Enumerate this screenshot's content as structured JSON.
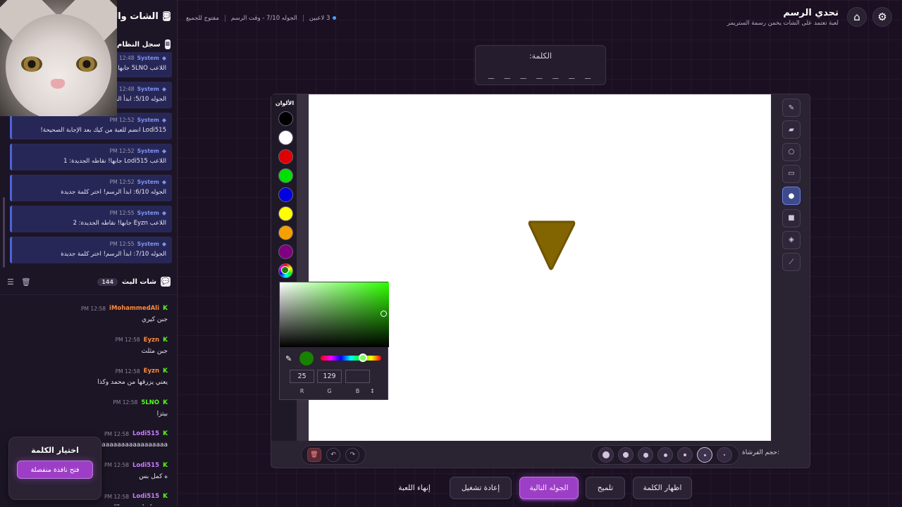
{
  "header": {
    "title": "تحدي الرسم",
    "subtitle": "لعبة تعتمد على الشات يخمن رسمة الستريمر",
    "status": {
      "players": "3 لاعبين",
      "round": "الجوله 7/10 - وقت الرسم",
      "open": "مفتوح للجميع"
    }
  },
  "sidebar": {
    "title": "الشات والس",
    "system_log_title": "سجل النظام",
    "system_messages": [
      {
        "sender": "System",
        "time": "12:48 PM",
        "text": "اللاعب 5LNO جابها! نقاطه الجديدة: 1"
      },
      {
        "sender": "System",
        "time": "12:48 PM",
        "text": "الجوله 5/10: ابدأ الرسم! اختر كلمة جديدة"
      },
      {
        "sender": "System",
        "time": "12:52 PM",
        "text": "Lodi515 انضم للعبة من كيك بعد الإجابة الصحيحة!"
      },
      {
        "sender": "System",
        "time": "12:52 PM",
        "text": "اللاعب Lodi515 جابها! نقاطه الجديدة: 1"
      },
      {
        "sender": "System",
        "time": "12:52 PM",
        "text": "الجوله 6/10: ابدأ الرسم! اختر كلمة جديدة"
      },
      {
        "sender": "System",
        "time": "12:55 PM",
        "text": "اللاعب Eyzn جابها! نقاطه الجديدة: 2"
      },
      {
        "sender": "System",
        "time": "12:55 PM",
        "text": "الجوله 7/10: ابدأ الرسم! اختر كلمة جديدة"
      }
    ],
    "chat_title": "شات البث",
    "chat_count": "144",
    "chat_messages": [
      {
        "user": "iMohammedAli",
        "time": "12:58 PM",
        "text": "جبن كيري",
        "color": "#ff8a3d"
      },
      {
        "user": "Eyzn",
        "time": "12:58 PM",
        "text": "جبن مثلث",
        "color": "#ff8a3d"
      },
      {
        "user": "Eyzn",
        "time": "12:58 PM",
        "text": "يعني يزرقها من محمد وكذا",
        "color": "#ff8a3d"
      },
      {
        "user": "5LNO",
        "time": "12:58 PM",
        "text": "بيتزا",
        "color": "#53fc18"
      },
      {
        "user": "Lodi515",
        "time": "12:58 PM",
        "text": "aaaaaaaaaaaaaaaaaaaaa",
        "color": "#c77dff"
      },
      {
        "user": "Lodi515",
        "time": "12:58 PM",
        "text": "ه كمل بس",
        "color": "#c77dff"
      },
      {
        "user": "Lodi515",
        "time": "12:58 PM",
        "text": "مرجعنا على نفس اللون",
        "color": "#c77dff"
      }
    ],
    "word_card": {
      "title": "اختيار الكلمة",
      "button": "فتح نافذة منفصلة"
    }
  },
  "word": {
    "label": "الكلمة:",
    "hint": "_ _ _ _   _ _ _"
  },
  "palette": {
    "label": "الألوان",
    "colors": [
      "#000000",
      "#ffffff",
      "#e00000",
      "#00e000",
      "#0000e0",
      "#ffff00",
      "#f5a000",
      "#800080"
    ]
  },
  "tools": [
    "pencil-icon",
    "eraser-icon",
    "circle-icon",
    "rectangle-icon",
    "filled-circle-icon",
    "filled-rectangle-icon",
    "fill-bucket-icon",
    "line-icon"
  ],
  "active_tool": "filled-circle-icon",
  "brush": {
    "label": "حجم الفرشاة:",
    "sizes": [
      16,
      12,
      10,
      8,
      6,
      4,
      2
    ],
    "active_size": 4
  },
  "drawing": {
    "shape": "inverted-triangle",
    "fill": "#826400",
    "stroke": "#6f5400"
  },
  "color_picker": {
    "current_color": "#198100",
    "r": "25",
    "g": "129",
    "b": "",
    "r_label": "R",
    "g_label": "G",
    "b_label": "B",
    "toggle": "↕"
  },
  "actions": {
    "reveal_word": "اظهار الكلمة",
    "hint": "تلميح",
    "next_round": "الجوله التالية",
    "restart": "إعادة تشغيل",
    "end_game": "إنهاء اللعبة"
  }
}
